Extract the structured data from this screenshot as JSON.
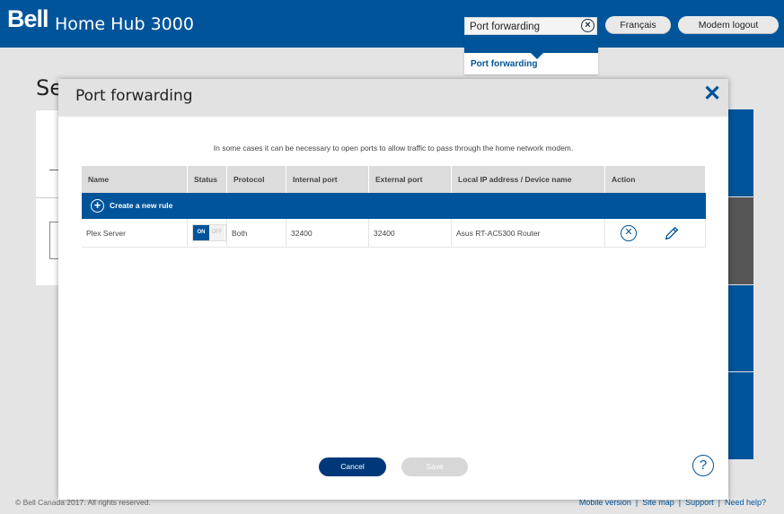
{
  "header": {
    "logo": "Bell",
    "product": "Home Hub 3000",
    "search": {
      "value": "Port forwarding",
      "clear_icon": "close-circle-icon"
    },
    "lang_button": "Français",
    "logout_button": "Modem logout",
    "suggestion": "Port forwarding"
  },
  "background": {
    "title": "Se"
  },
  "footer": {
    "copyright": "© Bell Canada 2017. All rights reserved.",
    "links": [
      "Mobile version",
      "Site map",
      "Support",
      "Need help?"
    ]
  },
  "modal": {
    "title": "Port forwarding",
    "intro": "In some cases it can be necessary to open ports to allow traffic to pass through the home network modem.",
    "columns": [
      "Name",
      "Status",
      "Protocol",
      "Internal port",
      "External port",
      "Local IP address / Device name",
      "Action"
    ],
    "create_rule": "Create a new rule",
    "rows": [
      {
        "name": "Plex Server",
        "status_on": "ON",
        "status_off": "OFF",
        "protocol": "Both",
        "internal": "32400",
        "external": "32400",
        "device": "Asus RT-AC5300 Router"
      }
    ],
    "cancel": "Cancel",
    "save": "Save",
    "help": "?"
  },
  "colors": {
    "brand": "#00549a",
    "dark_blue": "#003778"
  }
}
